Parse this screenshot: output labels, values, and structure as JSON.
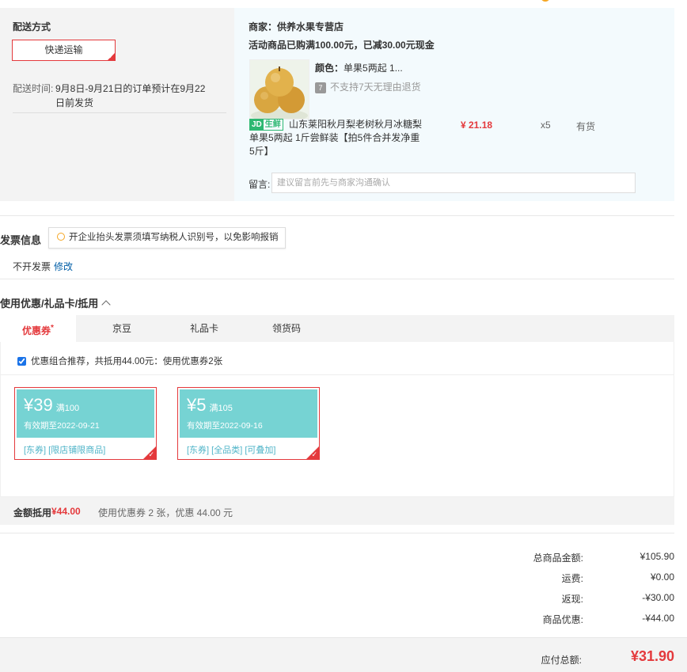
{
  "delivery": {
    "title": "配送方式",
    "method": "快递运输",
    "time_label": "配送时间:",
    "time_value": "9月8日-9月21日的订单预计在9月22日前发货"
  },
  "shop": {
    "merchant": "商家：供养水果专营店",
    "promo": "活动商品已购满100.00元，已减30.00元现金",
    "product": {
      "color_label": "颜色：",
      "color_value": "单果5两起 1...",
      "no_return_icon": "7",
      "no_return": "不支持7天无理由退货",
      "fresh_badge_icon": "JD",
      "fresh_badge_text": "生鲜",
      "name": "山东莱阳秋月梨老树秋月冰糖梨 单果5两起 1斤尝鲜装【拍5件合并发净重5斤】",
      "price": "¥ 21.18",
      "qty": "x5",
      "stock": "有货"
    },
    "message_label": "留言:",
    "message_placeholder": "建议留言前先与商家沟通确认"
  },
  "invoice": {
    "title": "发票信息",
    "tip": "开企业抬头发票须填写纳税人识别号，以免影响报销",
    "status": "不开发票",
    "edit": "修改"
  },
  "coupons": {
    "title": "使用优惠/礼品卡/抵用",
    "tabs": [
      {
        "label": "优惠券",
        "active": true
      },
      {
        "label": "京豆",
        "active": false
      },
      {
        "label": "礼品卡",
        "active": false
      },
      {
        "label": "领货码",
        "active": false
      }
    ],
    "combo_text": "优惠组合推荐，共抵用44.00元：使用优惠券2张",
    "items": [
      {
        "amount": "¥39",
        "condition": "满100",
        "expiry": "有效期至2022-09-21",
        "tags": "[东券]  [限店铺限商品]"
      },
      {
        "amount": "¥5",
        "condition": "满105",
        "expiry": "有效期至2022-09-16",
        "tags": "[东券]  [全品类]  [可叠加]"
      }
    ],
    "summary_label": "金额抵用",
    "summary_amount": "¥44.00",
    "summary_desc": "使用优惠券 2 张，优惠 44.00 元"
  },
  "totals": [
    {
      "label": "总商品金额:",
      "value": "¥105.90"
    },
    {
      "label": "运费:",
      "value": "¥0.00"
    },
    {
      "label": "返现:",
      "value": "-¥30.00"
    },
    {
      "label": "商品优惠:",
      "value": "-¥44.00"
    }
  ],
  "payable": {
    "label": "应付总额:",
    "value": "¥31.90"
  },
  "colors": {
    "accent": "#e4393c",
    "coupon_bg": "#76d3d3",
    "link": "#005ea7"
  }
}
